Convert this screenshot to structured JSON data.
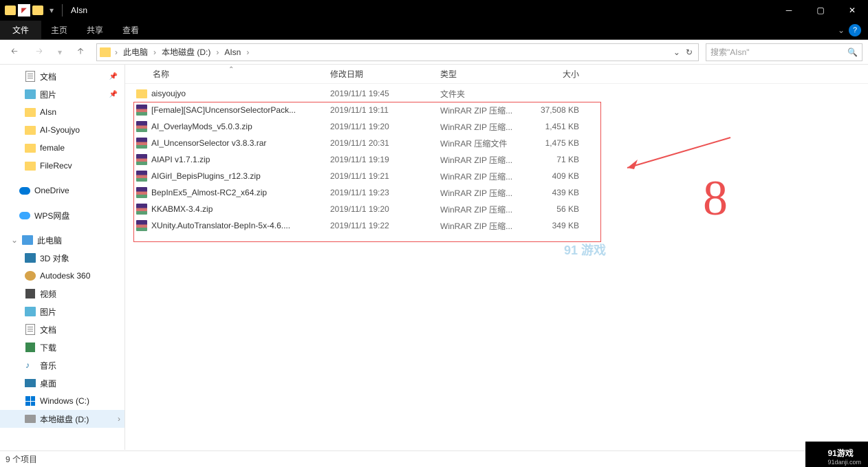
{
  "window": {
    "title": "AIsn"
  },
  "ribbon": {
    "file": "文件",
    "tabs": [
      "主页",
      "共享",
      "查看"
    ]
  },
  "breadcrumb": {
    "items": [
      "此电脑",
      "本地磁盘 (D:)",
      "AIsn"
    ]
  },
  "search": {
    "placeholder": "搜索\"AIsn\""
  },
  "sidebar": {
    "quick": [
      {
        "label": "文档",
        "pin": true,
        "icon": "doc"
      },
      {
        "label": "图片",
        "pin": true,
        "icon": "pic"
      },
      {
        "label": "AIsn",
        "icon": "folder"
      },
      {
        "label": "AI-Syoujyo",
        "icon": "folder"
      },
      {
        "label": "female",
        "icon": "folder"
      },
      {
        "label": "FileRecv",
        "icon": "folder"
      }
    ],
    "onedrive": "OneDrive",
    "wps": "WPS网盘",
    "thispc": "此电脑",
    "pcitems": [
      {
        "label": "3D 对象",
        "icon": "3d"
      },
      {
        "label": "Autodesk 360",
        "icon": "ad"
      },
      {
        "label": "视频",
        "icon": "video"
      },
      {
        "label": "图片",
        "icon": "pic"
      },
      {
        "label": "文档",
        "icon": "doc"
      },
      {
        "label": "下载",
        "icon": "down"
      },
      {
        "label": "音乐",
        "icon": "music"
      },
      {
        "label": "桌面",
        "icon": "desk"
      },
      {
        "label": "Windows (C:)",
        "icon": "win"
      },
      {
        "label": "本地磁盘 (D:)",
        "icon": "drive"
      }
    ]
  },
  "columns": {
    "name": "名称",
    "date": "修改日期",
    "type": "类型",
    "size": "大小"
  },
  "files": [
    {
      "name": "aisyoujyo",
      "date": "2019/11/1 19:45",
      "type": "文件夹",
      "size": "",
      "icon": "folder"
    },
    {
      "name": "[Female][SAC]UncensorSelectorPack...",
      "date": "2019/11/1 19:11",
      "type": "WinRAR ZIP 压缩...",
      "size": "37,508 KB",
      "icon": "rar"
    },
    {
      "name": "AI_OverlayMods_v5.0.3.zip",
      "date": "2019/11/1 19:20",
      "type": "WinRAR ZIP 压缩...",
      "size": "1,451 KB",
      "icon": "rar"
    },
    {
      "name": "AI_UncensorSelector v3.8.3.rar",
      "date": "2019/11/1 20:31",
      "type": "WinRAR 压缩文件",
      "size": "1,475 KB",
      "icon": "rar"
    },
    {
      "name": "AIAPI v1.7.1.zip",
      "date": "2019/11/1 19:19",
      "type": "WinRAR ZIP 压缩...",
      "size": "71 KB",
      "icon": "rar"
    },
    {
      "name": "AIGirl_BepisPlugins_r12.3.zip",
      "date": "2019/11/1 19:21",
      "type": "WinRAR ZIP 压缩...",
      "size": "409 KB",
      "icon": "rar"
    },
    {
      "name": "BepInEx5_Almost-RC2_x64.zip",
      "date": "2019/11/1 19:23",
      "type": "WinRAR ZIP 压缩...",
      "size": "439 KB",
      "icon": "rar"
    },
    {
      "name": "KKABMX-3.4.zip",
      "date": "2019/11/1 19:20",
      "type": "WinRAR ZIP 压缩...",
      "size": "56 KB",
      "icon": "rar"
    },
    {
      "name": "XUnity.AutoTranslator-BepIn-5x-4.6....",
      "date": "2019/11/1 19:22",
      "type": "WinRAR ZIP 压缩...",
      "size": "349 KB",
      "icon": "rar"
    }
  ],
  "status": {
    "text": "9 个项目"
  },
  "watermarks": {
    "top": "91 游戏",
    "logo": "91游戏",
    "sub": "91danji.com"
  },
  "annotation": {
    "eight": "8"
  }
}
